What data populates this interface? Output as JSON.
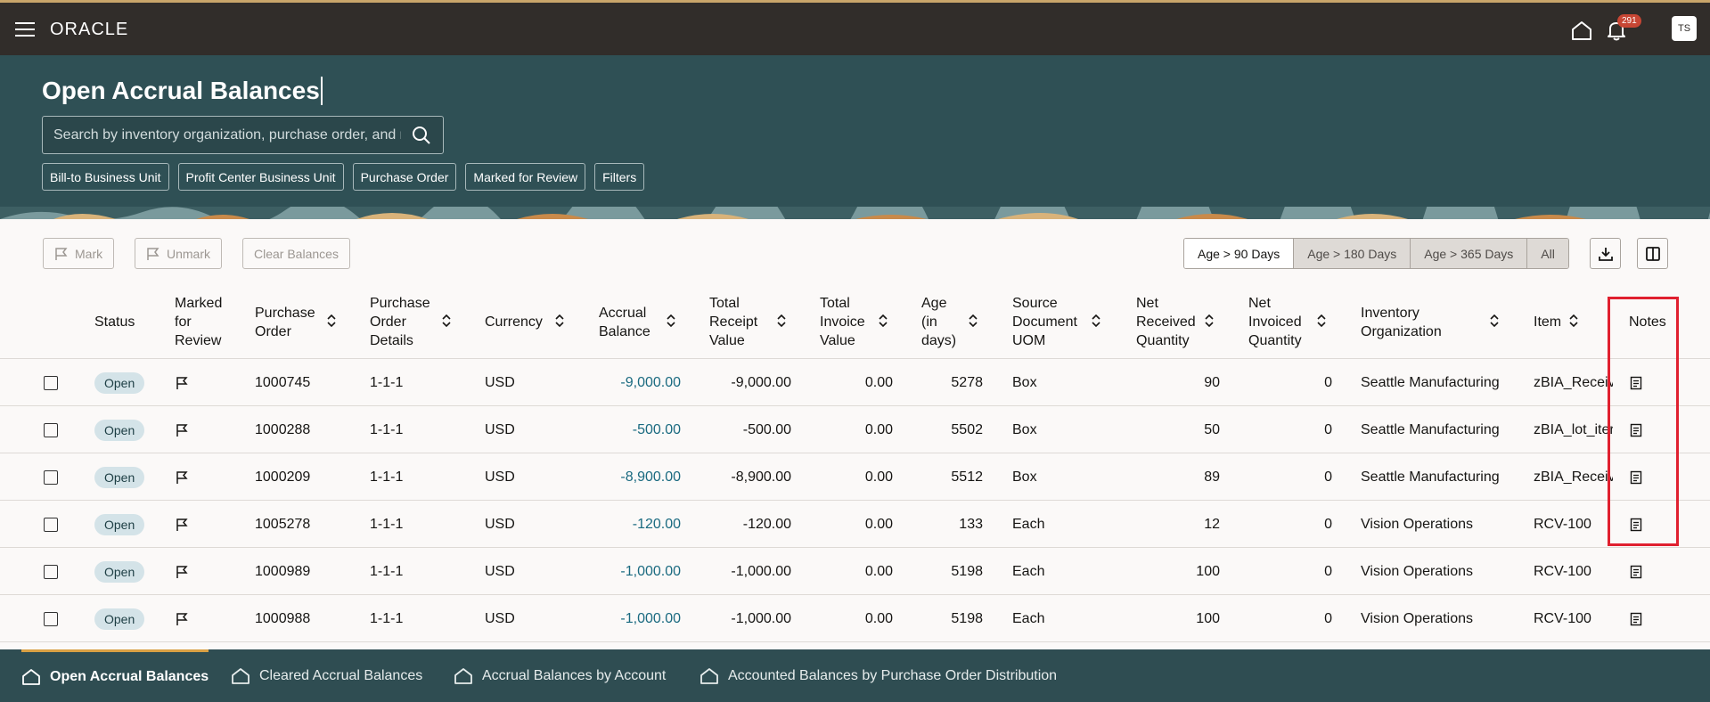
{
  "app": {
    "logo": "ORACLE",
    "notification_count": "291",
    "user_initials": "TS"
  },
  "header": {
    "title": "Open Accrual Balances",
    "search_placeholder": "Search by inventory organization, purchase order, and more",
    "chips": [
      "Bill-to Business Unit",
      "Profit Center Business Unit",
      "Purchase Order",
      "Marked for Review",
      "Filters"
    ]
  },
  "toolbar": {
    "mark_label": "Mark",
    "unmark_label": "Unmark",
    "clear_label": "Clear Balances",
    "age_filters": [
      "Age > 90 Days",
      "Age > 180 Days",
      "Age > 365 Days",
      "All"
    ],
    "selected_age_filter": "Age > 90 Days"
  },
  "table": {
    "columns": [
      "Status",
      "Marked for Review",
      "Purchase Order",
      "Purchase Order Details",
      "Currency",
      "Accrual Balance",
      "Total Receipt Value",
      "Total Invoice Value",
      "Age (in days)",
      "Source Document UOM",
      "Net Received Quantity",
      "Net Invoiced Quantity",
      "Inventory Organization",
      "Item",
      "Notes"
    ],
    "rows": [
      {
        "status": "Open",
        "po": "1000745",
        "details": "1-1-1",
        "currency": "USD",
        "accrual": "-9,000.00",
        "receipt": "-9,000.00",
        "invoice": "0.00",
        "age": "5278",
        "uom": "Box",
        "net_received": "90",
        "net_invoiced": "0",
        "org": "Seattle Manufacturing",
        "item": "zBIA_Receiv"
      },
      {
        "status": "Open",
        "po": "1000288",
        "details": "1-1-1",
        "currency": "USD",
        "accrual": "-500.00",
        "receipt": "-500.00",
        "invoice": "0.00",
        "age": "5502",
        "uom": "Box",
        "net_received": "50",
        "net_invoiced": "0",
        "org": "Seattle Manufacturing",
        "item": "zBIA_lot_iter"
      },
      {
        "status": "Open",
        "po": "1000209",
        "details": "1-1-1",
        "currency": "USD",
        "accrual": "-8,900.00",
        "receipt": "-8,900.00",
        "invoice": "0.00",
        "age": "5512",
        "uom": "Box",
        "net_received": "89",
        "net_invoiced": "0",
        "org": "Seattle Manufacturing",
        "item": "zBIA_Receiv"
      },
      {
        "status": "Open",
        "po": "1005278",
        "details": "1-1-1",
        "currency": "USD",
        "accrual": "-120.00",
        "receipt": "-120.00",
        "invoice": "0.00",
        "age": "133",
        "uom": "Each",
        "net_received": "12",
        "net_invoiced": "0",
        "org": "Vision Operations",
        "item": "RCV-100"
      },
      {
        "status": "Open",
        "po": "1000989",
        "details": "1-1-1",
        "currency": "USD",
        "accrual": "-1,000.00",
        "receipt": "-1,000.00",
        "invoice": "0.00",
        "age": "5198",
        "uom": "Each",
        "net_received": "100",
        "net_invoiced": "0",
        "org": "Vision Operations",
        "item": "RCV-100"
      },
      {
        "status": "Open",
        "po": "1000988",
        "details": "1-1-1",
        "currency": "USD",
        "accrual": "-1,000.00",
        "receipt": "-1,000.00",
        "invoice": "0.00",
        "age": "5198",
        "uom": "Each",
        "net_received": "100",
        "net_invoiced": "0",
        "org": "Vision Operations",
        "item": "RCV-100"
      }
    ]
  },
  "bottom_tabs": [
    "Open Accrual Balances",
    "Cleared Accrual Balances",
    "Accrual Balances by Account",
    "Accounted Balances by Purchase Order Distribution"
  ],
  "colors": {
    "topbar": "#312d2a",
    "header": "#2f5055",
    "bottombar": "#2f4d52",
    "link": "#1a6a80",
    "highlight": "#e0202f",
    "badge": "#c74634"
  }
}
